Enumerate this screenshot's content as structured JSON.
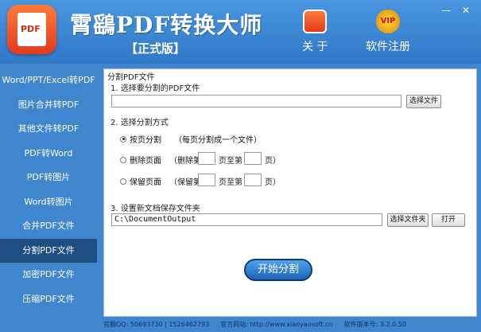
{
  "window": {
    "minimize": "—",
    "close": "✕"
  },
  "header": {
    "logo_text": "PDF",
    "title": "霄鷂PDF转换大师",
    "edition": "【正式版】",
    "about": "关 于",
    "register": "软件注册",
    "vip": "VIP"
  },
  "sidebar": {
    "items": [
      "Word/PPT/Excel转PDF",
      "图片合并转PDF",
      "其他文件转PDF",
      "PDF转Word",
      "PDF转图片",
      "Word转图片",
      "合并PDF文件",
      "分割PDF文件",
      "加密PDF文件",
      "压缩PDF文件"
    ],
    "active_index": 7
  },
  "main": {
    "section_title": "分割PDF文件",
    "step1": "1. 选择要分割的PDF文件",
    "file_value": "",
    "select_file": "选择文件",
    "step2": "2. 选择分割方式",
    "opt_page": "按页分割",
    "opt_page_note": "（每页分割成一个文件）",
    "opt_delete": "删除页面",
    "delete_from": "（删除第",
    "delete_to": "页至第",
    "delete_end": "页）",
    "opt_keep": "保留页面",
    "keep_from": "（保留第",
    "keep_to": "页至第",
    "keep_end": "页）",
    "step3": "3. 设置新文档保存文件夹",
    "folder_value": "C:\\DocumentOutput",
    "select_folder": "选择文件夹",
    "open": "打开",
    "start": "开始分割"
  },
  "footer": {
    "qq": "官翻QQ: 50693730 | 1526462793",
    "site": "官方网站: http://www.xiaoyaosoft.cn",
    "version": "软件版本号: 3.2.0.50"
  },
  "colors": {
    "accent": "#3f86cf",
    "nav_active": "#1f4f82"
  }
}
